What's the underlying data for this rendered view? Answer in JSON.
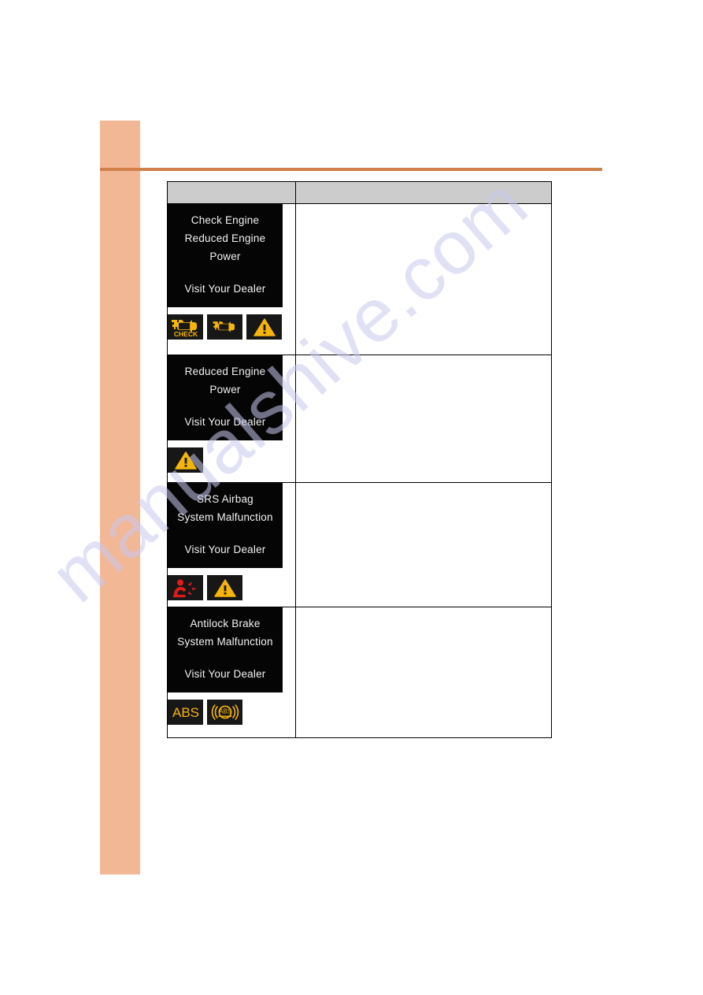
{
  "page": {
    "watermark": "manualshive.com",
    "accent_sidebar_color": "#f2b795",
    "accent_rule_color": "#d2804a",
    "table_header_color": "#cccccc",
    "display_background": "#050505",
    "display_text_color": "#f2f2f2",
    "icon_amber": "#f5b50a",
    "icon_red": "#e01b1b"
  },
  "table": {
    "headers": {
      "symbol_column": "",
      "description_column": ""
    },
    "rows": [
      {
        "id": "check-engine-reduced-power",
        "display_lines": [
          "Check Engine",
          "Reduced Engine",
          "Power"
        ],
        "display_footer": "Visit Your Dealer",
        "icons": [
          {
            "name": "check-engine-check-icon",
            "label": "CHECK",
            "color": "#f5b50a"
          },
          {
            "name": "engine-malfunction-icon",
            "label": "",
            "color": "#f5b50a"
          },
          {
            "name": "master-warning-icon",
            "label": "",
            "color": "#f5b50a"
          }
        ],
        "description": ""
      },
      {
        "id": "reduced-engine-power",
        "display_lines": [
          "Reduced Engine",
          "Power"
        ],
        "display_footer": "Visit Your Dealer",
        "icons": [
          {
            "name": "master-warning-icon",
            "label": "",
            "color": "#f5b50a"
          }
        ],
        "description": ""
      },
      {
        "id": "srs-airbag-system-malfunction",
        "display_lines": [
          "SRS Airbag",
          "System Malfunction"
        ],
        "display_footer": "Visit Your Dealer",
        "icons": [
          {
            "name": "srs-airbag-icon",
            "label": "",
            "color": "#e01b1b"
          },
          {
            "name": "master-warning-icon",
            "label": "",
            "color": "#f5b50a"
          }
        ],
        "description": ""
      },
      {
        "id": "antilock-brake-system-malfunction",
        "display_lines": [
          "Antilock Brake",
          "System Malfunction"
        ],
        "display_footer": "Visit Your Dealer",
        "icons": [
          {
            "name": "abs-text-icon",
            "label": "ABS",
            "color": "#f5b50a"
          },
          {
            "name": "abs-symbol-icon",
            "label": "ABS",
            "color": "#f5b50a"
          }
        ],
        "description": ""
      }
    ]
  }
}
